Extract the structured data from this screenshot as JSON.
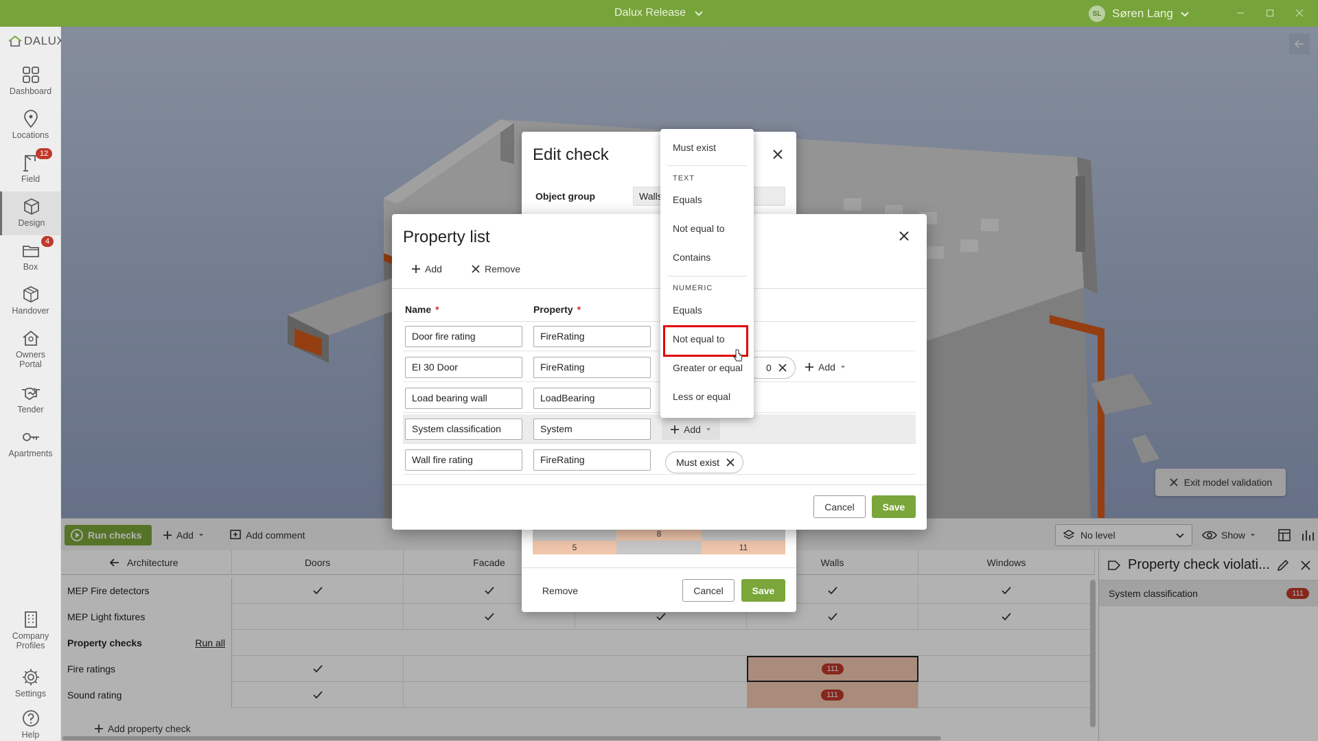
{
  "titlebar": {
    "project": "Dalux Release",
    "user_initials": "SL",
    "user_name": "Søren Lang"
  },
  "sidebar": {
    "logo": "DALUX",
    "items": [
      {
        "label": "Dashboard"
      },
      {
        "label": "Locations"
      },
      {
        "label": "Field",
        "badge": "12"
      },
      {
        "label": "Design"
      },
      {
        "label": "Box",
        "badge": "4"
      },
      {
        "label": "Handover"
      },
      {
        "label": "Owners Portal"
      },
      {
        "label": "Tender"
      },
      {
        "label": "Apartments"
      },
      {
        "label": "Company Profiles"
      },
      {
        "label": "Settings"
      },
      {
        "label": "Help"
      }
    ]
  },
  "viewport": {
    "exit_validation": "Exit model validation"
  },
  "toolbar": {
    "run_checks": "Run checks",
    "add": "Add",
    "add_comment": "Add comment",
    "level": "No level",
    "show": "Show"
  },
  "grid": {
    "back_label": "Architecture",
    "columns": [
      "Doors",
      "Facade",
      "",
      "Walls",
      "Windows"
    ],
    "rows": [
      {
        "label": "MEP Fire detectors"
      },
      {
        "label": "MEP Light fixtures"
      },
      {
        "label": "Property checks",
        "action": "Run all"
      },
      {
        "label": "Fire ratings",
        "violations": "111"
      },
      {
        "label": "Sound rating",
        "violations": "111"
      }
    ],
    "add_property_check": "Add property check"
  },
  "violations_panel": {
    "title": "Property check violati...",
    "item": "System classification",
    "count": "111"
  },
  "edit_check": {
    "title": "Edit check",
    "object_group_label": "Object group",
    "object_group_value": "Walls",
    "heat_values": [
      "8",
      "5",
      "11"
    ],
    "remove": "Remove",
    "cancel": "Cancel",
    "save": "Save"
  },
  "property_list": {
    "title": "Property list",
    "add": "Add",
    "remove": "Remove",
    "col_name": "Name",
    "col_property": "Property",
    "rows": [
      {
        "name": "Door fire rating",
        "property": "FireRating"
      },
      {
        "name": "EI 30 Door",
        "property": "FireRating",
        "chip_fragment": "0",
        "add": "Add"
      },
      {
        "name": "Load bearing wall",
        "property": "LoadBearing"
      },
      {
        "name": "System classification",
        "property": "System",
        "add": "Add"
      },
      {
        "name": "Wall fire rating",
        "property": "FireRating",
        "chip": "Must exist"
      }
    ],
    "cancel": "Cancel",
    "save": "Save"
  },
  "dropdown": {
    "must_exist": "Must exist",
    "text_header": "TEXT",
    "text_items": [
      "Equals",
      "Not equal to",
      "Contains"
    ],
    "numeric_header": "NUMERIC",
    "numeric_items": [
      "Equals",
      "Not equal to",
      "Greater or equal",
      "Less or equal"
    ],
    "highlighted": "Not equal to"
  },
  "colors": {
    "brand_green": "#76a33a",
    "button_green": "#7aa63a",
    "violation_red": "#c0392b",
    "highlight_red": "#e00000"
  }
}
